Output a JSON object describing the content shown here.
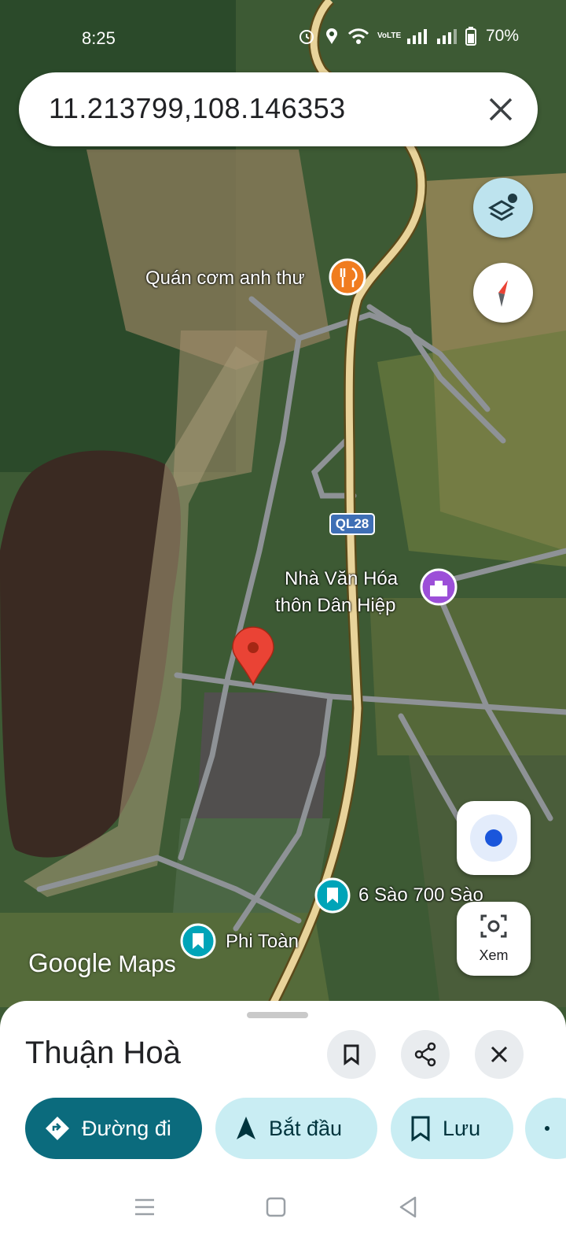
{
  "status_bar": {
    "time": "8:25",
    "battery": "70%",
    "volte_label": "VoLTE"
  },
  "search": {
    "value": "11.213799,108.146353"
  },
  "map": {
    "labels": {
      "restaurant": "Quán cơm anh thư",
      "highway": "QL28",
      "cultural_house_line1": "Nhà Văn Hóa",
      "cultural_house_line2": "thôn Dân Hiệp",
      "poi_1": "6 Sào 700 Sào",
      "poi_2": "Phi Toàn"
    },
    "logo": {
      "google": "Google",
      "maps": "Maps"
    },
    "view_button_label": "Xem",
    "colors": {
      "pin": "#ea4335",
      "restaurant_icon": "#f07c1f",
      "culture_icon": "#9c4fd8",
      "saved_icon": "#00a4b8"
    }
  },
  "sheet": {
    "title": "Thuận Hoà",
    "chips": {
      "directions": "Đường đi",
      "start": "Bắt đầu",
      "save": "Lưu"
    },
    "accent": "#0b6b7d"
  }
}
